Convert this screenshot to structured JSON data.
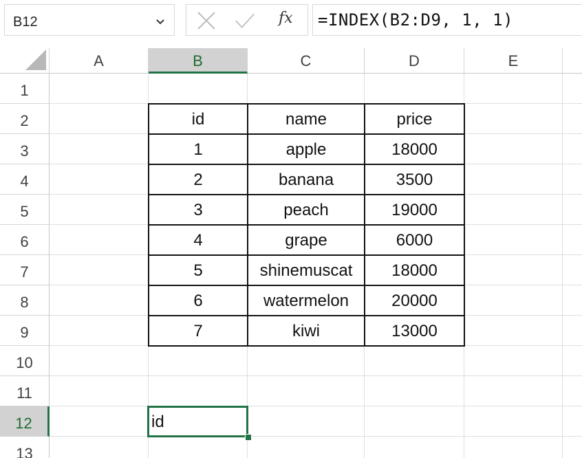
{
  "name_box": {
    "value": "B12"
  },
  "formula_bar": {
    "cancel_icon": "cancel-x-icon",
    "enter_icon": "check-icon",
    "function_label": "fx",
    "formula": "=INDEX(B2:D9, 1, 1)"
  },
  "columns": [
    "A",
    "B",
    "C",
    "D",
    "E"
  ],
  "active_column": "B",
  "rows": [
    "1",
    "2",
    "3",
    "4",
    "5",
    "6",
    "7",
    "8",
    "9",
    "10",
    "11",
    "12",
    "13"
  ],
  "active_row": "12",
  "table": {
    "headers": [
      "id",
      "name",
      "price"
    ],
    "records": [
      [
        "1",
        "apple",
        "18000"
      ],
      [
        "2",
        "banana",
        "3500"
      ],
      [
        "3",
        "peach",
        "19000"
      ],
      [
        "4",
        "grape",
        "6000"
      ],
      [
        "5",
        "shinemuscat",
        "18000"
      ],
      [
        "6",
        "watermelon",
        "20000"
      ],
      [
        "7",
        "kiwi",
        "13000"
      ]
    ]
  },
  "selected_cell": {
    "ref": "B12",
    "value": "id"
  },
  "colors": {
    "accent": "#217346",
    "header_active_bg": "#d2d2d2",
    "gridline": "#dedede"
  }
}
